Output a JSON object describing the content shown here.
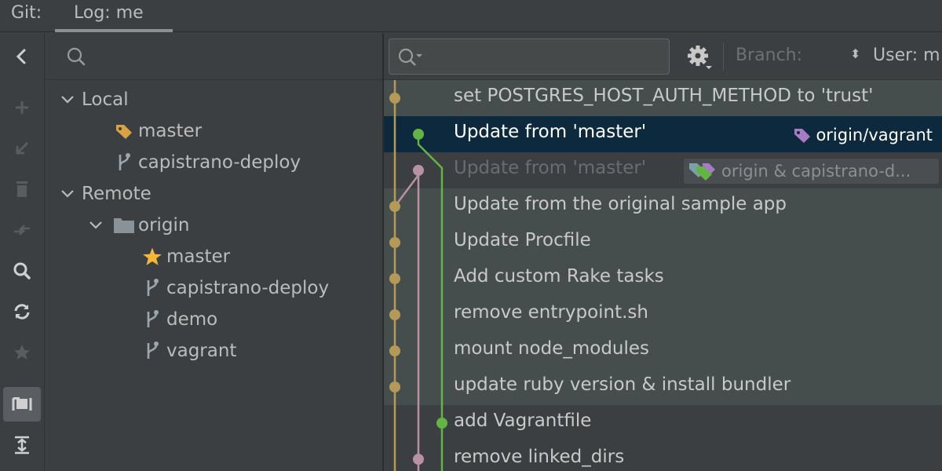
{
  "tabbar": {
    "prefix": "Git:",
    "active_tab": "Log: me"
  },
  "toolbar": {
    "buttons": [
      "collapse-icon",
      "add-icon",
      "checkout-icon",
      "delete-icon",
      "compare-icon",
      "search-icon",
      "refresh-icon",
      "favorite-icon",
      "group-icon",
      "expand-all-icon"
    ]
  },
  "branches": {
    "local_label": "Local",
    "local": [
      {
        "name": "master",
        "icon": "tag-icon"
      },
      {
        "name": "capistrano-deploy",
        "icon": "branch-icon"
      }
    ],
    "remote_label": "Remote",
    "remote_group": "origin",
    "remote": [
      {
        "name": "master",
        "icon": "star-icon"
      },
      {
        "name": "capistrano-deploy",
        "icon": "branch-icon"
      },
      {
        "name": "demo",
        "icon": "branch-icon"
      },
      {
        "name": "vagrant",
        "icon": "branch-icon"
      }
    ]
  },
  "filter": {
    "search_placeholder": "",
    "branch_label": "Branch:",
    "user_label": "User: m"
  },
  "commits": [
    {
      "message": "set POSTGRES_HOST_AUTH_METHOD to 'trust'"
    },
    {
      "message": "Update from 'master'",
      "ref": "origin/vagrant"
    },
    {
      "message": "Update from 'master'",
      "ref": "origin & capistrano-d..."
    },
    {
      "message": "Update from the original sample app"
    },
    {
      "message": "Update Procfile"
    },
    {
      "message": "Add custom Rake tasks"
    },
    {
      "message": "remove entrypoint.sh"
    },
    {
      "message": "mount node_modules"
    },
    {
      "message": "update ruby version & install bundler"
    },
    {
      "message": "add Vagrantfile"
    },
    {
      "message": "remove linked_dirs"
    }
  ],
  "colors": {
    "selection": "#0d293e",
    "highlight_row": "#464d4d",
    "graph_gold": "#b59a57",
    "graph_green": "#62b543",
    "graph_mauve": "#b892a4",
    "tag_gold": "#d9a343",
    "tag_purple": "#a87bc4"
  }
}
